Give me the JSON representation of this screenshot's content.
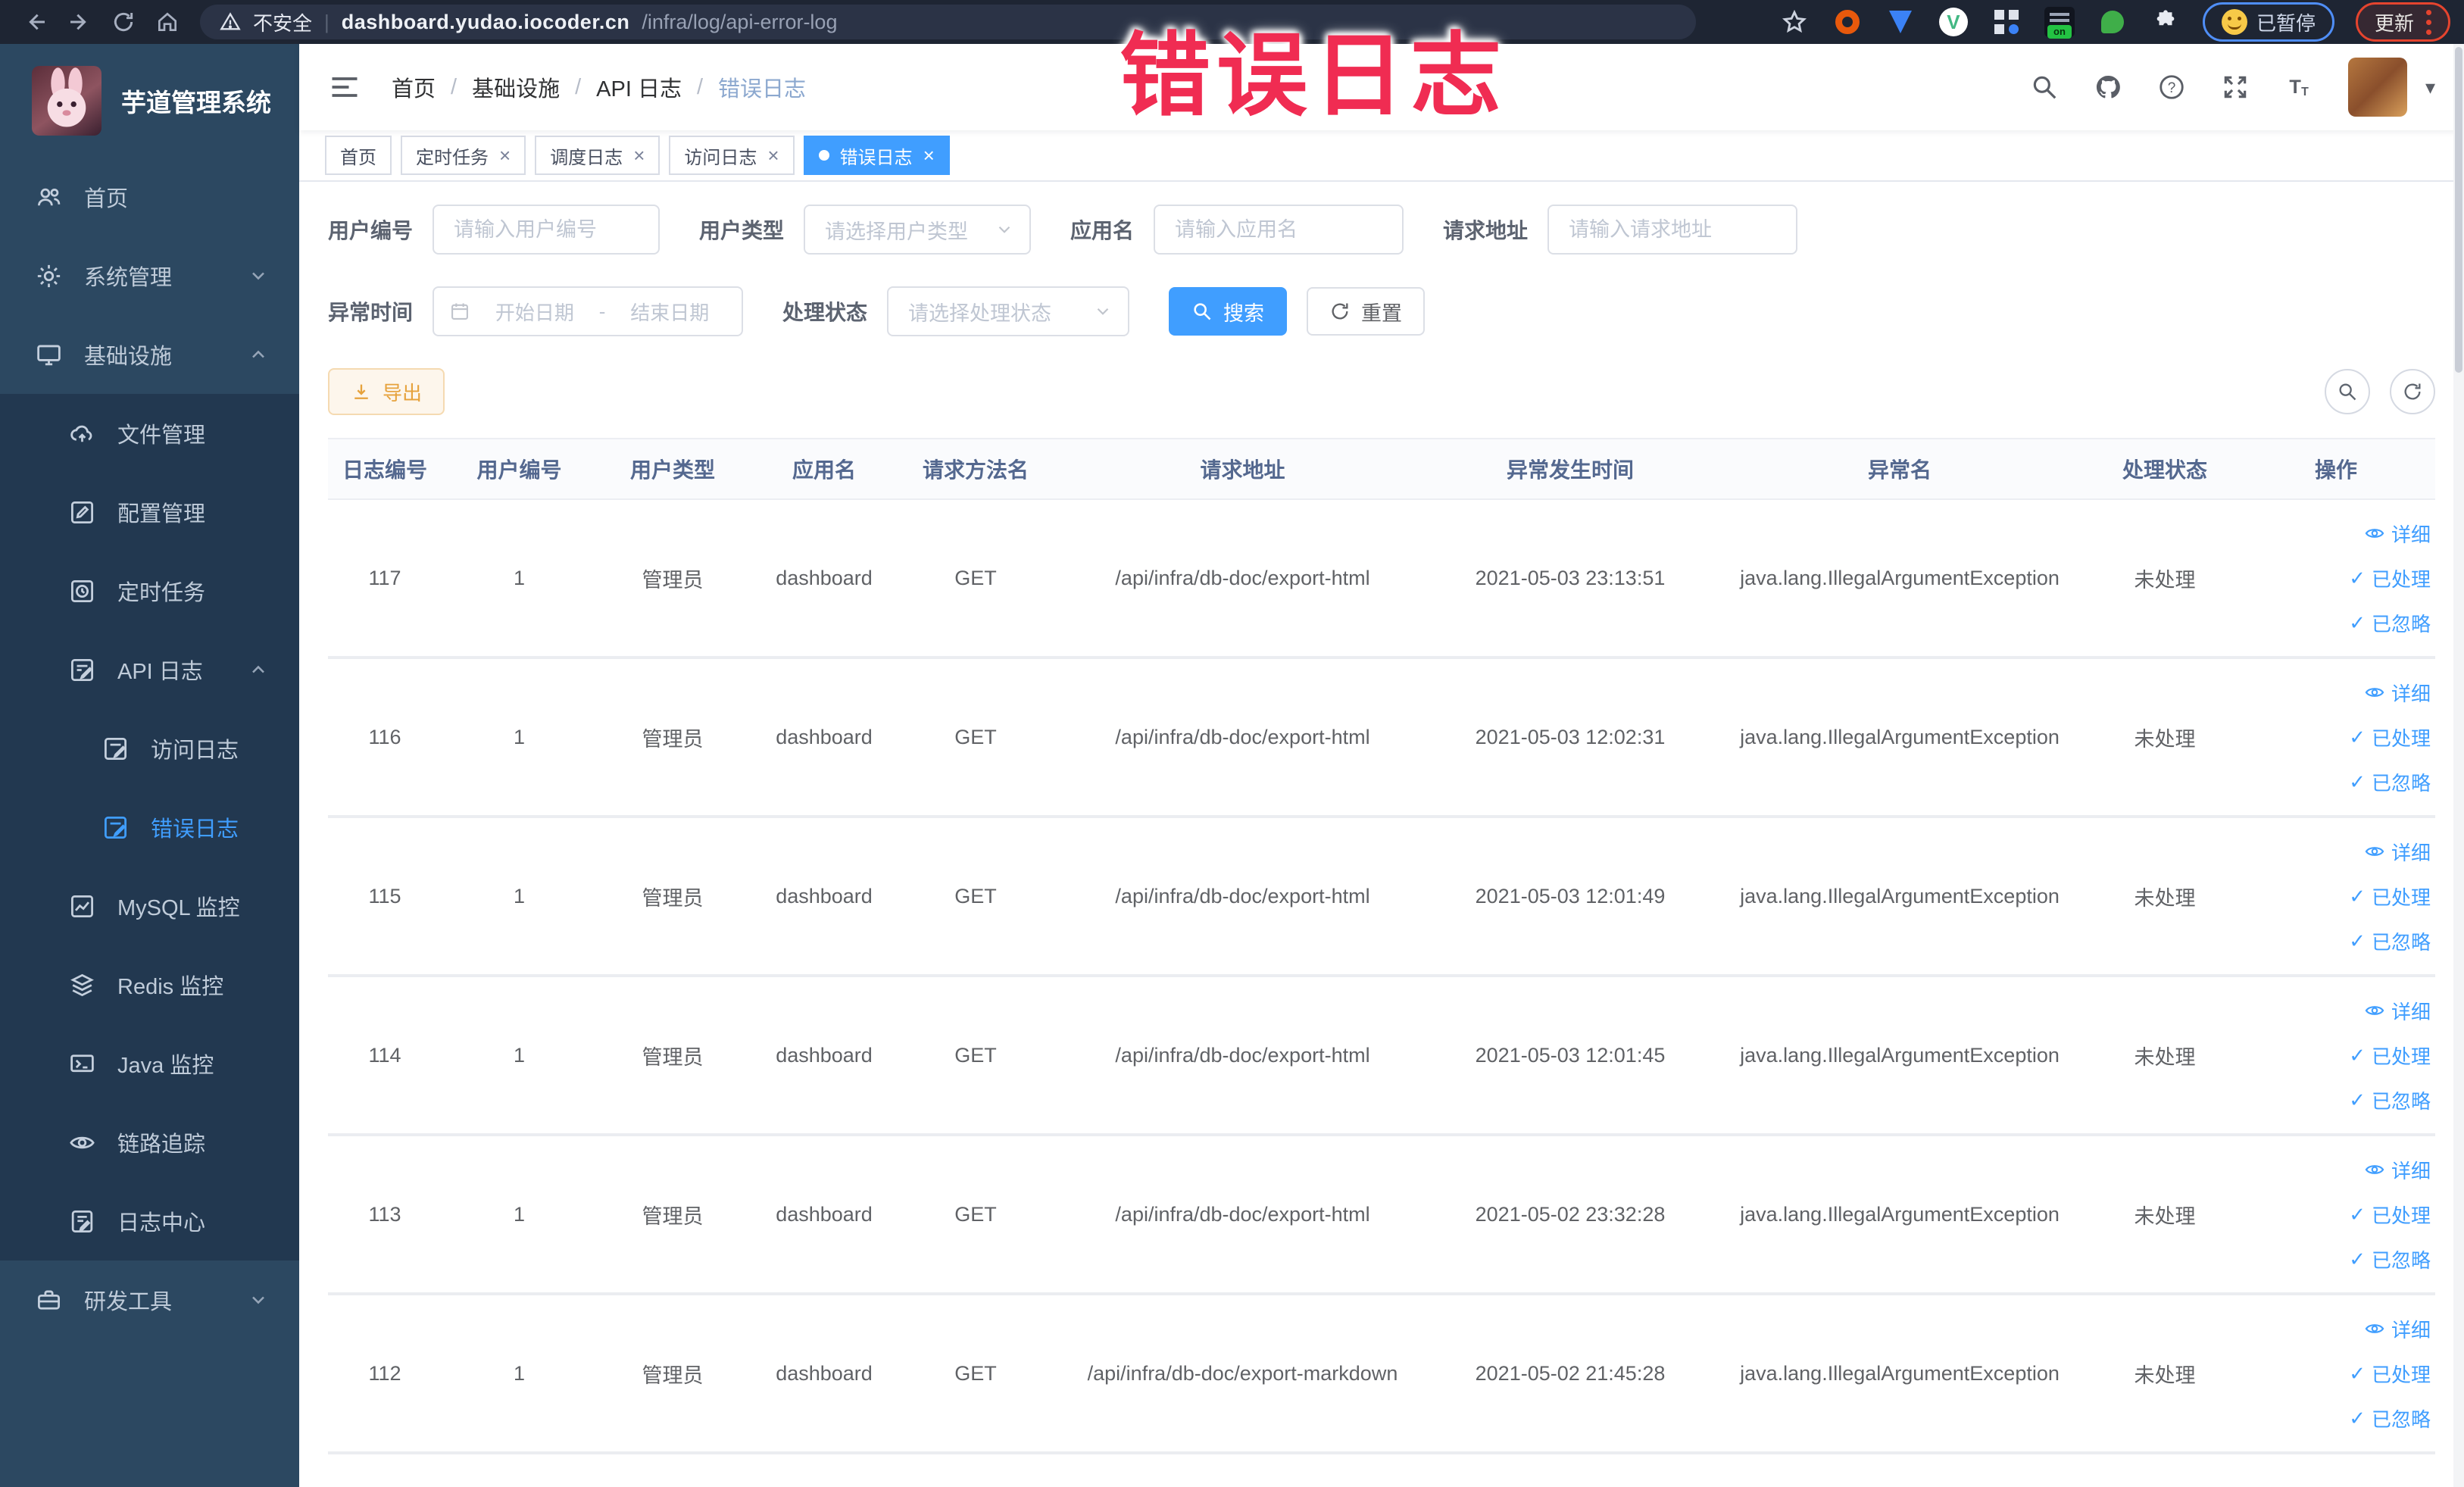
{
  "browser": {
    "security_label": "不安全",
    "url_domain": "dashboard.yudao.iocoder.cn",
    "url_path": "/infra/log/api-error-log",
    "paused_label": "已暂停",
    "update_label": "更新"
  },
  "annotation": {
    "text": "错误日志",
    "color": "#f02c52"
  },
  "icons": {
    "check": "✓",
    "close": "×",
    "caret_down": "▾",
    "slash": "/",
    "pipe": "|",
    "question": "?",
    "letter_big": "T",
    "letter_small": "T"
  },
  "sidebar": {
    "title": "芋道管理系统",
    "items": [
      {
        "label": "首页"
      },
      {
        "label": "系统管理"
      },
      {
        "label": "基础设施"
      },
      {
        "label": "文件管理"
      },
      {
        "label": "配置管理"
      },
      {
        "label": "定时任务"
      },
      {
        "label": "API 日志"
      },
      {
        "label": "访问日志"
      },
      {
        "label": "错误日志"
      },
      {
        "label": "MySQL 监控"
      },
      {
        "label": "Redis 监控"
      },
      {
        "label": "Java 监控"
      },
      {
        "label": "链路追踪"
      },
      {
        "label": "日志中心"
      },
      {
        "label": "研发工具"
      }
    ]
  },
  "breadcrumb": [
    "首页",
    "基础设施",
    "API 日志",
    "错误日志"
  ],
  "tabs": [
    {
      "label": "首页"
    },
    {
      "label": "定时任务"
    },
    {
      "label": "调度日志"
    },
    {
      "label": "访问日志"
    },
    {
      "label": "错误日志"
    }
  ],
  "filters": {
    "user_id_label": "用户编号",
    "user_id_placeholder": "请输入用户编号",
    "user_type_label": "用户类型",
    "user_type_placeholder": "请选择用户类型",
    "app_name_label": "应用名",
    "app_name_placeholder": "请输入应用名",
    "request_url_label": "请求地址",
    "request_url_placeholder": "请输入请求地址",
    "exception_time_label": "异常时间",
    "date_start_placeholder": "开始日期",
    "date_separator": "-",
    "date_end_placeholder": "结束日期",
    "process_status_label": "处理状态",
    "process_status_placeholder": "请选择处理状态",
    "search_label": "搜索",
    "reset_label": "重置"
  },
  "toolbar": {
    "export_label": "导出"
  },
  "table": {
    "columns": [
      "日志编号",
      "用户编号",
      "用户类型",
      "应用名",
      "请求方法名",
      "请求地址",
      "异常发生时间",
      "异常名",
      "处理状态",
      "操作"
    ],
    "action_labels": {
      "detail": "详细",
      "processed": "已处理",
      "ignored": "已忽略"
    },
    "rows": [
      {
        "log_id": "117",
        "user_id": "1",
        "user_type": "管理员",
        "app_name": "dashboard",
        "method": "GET",
        "url": "/api/infra/db-doc/export-html",
        "time": "2021-05-03 23:13:51",
        "exception": "java.lang.IllegalArgumentException",
        "status": "未处理"
      },
      {
        "log_id": "116",
        "user_id": "1",
        "user_type": "管理员",
        "app_name": "dashboard",
        "method": "GET",
        "url": "/api/infra/db-doc/export-html",
        "time": "2021-05-03 12:02:31",
        "exception": "java.lang.IllegalArgumentException",
        "status": "未处理"
      },
      {
        "log_id": "115",
        "user_id": "1",
        "user_type": "管理员",
        "app_name": "dashboard",
        "method": "GET",
        "url": "/api/infra/db-doc/export-html",
        "time": "2021-05-03 12:01:49",
        "exception": "java.lang.IllegalArgumentException",
        "status": "未处理"
      },
      {
        "log_id": "114",
        "user_id": "1",
        "user_type": "管理员",
        "app_name": "dashboard",
        "method": "GET",
        "url": "/api/infra/db-doc/export-html",
        "time": "2021-05-03 12:01:45",
        "exception": "java.lang.IllegalArgumentException",
        "status": "未处理"
      },
      {
        "log_id": "113",
        "user_id": "1",
        "user_type": "管理员",
        "app_name": "dashboard",
        "method": "GET",
        "url": "/api/infra/db-doc/export-html",
        "time": "2021-05-02 23:32:28",
        "exception": "java.lang.IllegalArgumentException",
        "status": "未处理"
      },
      {
        "log_id": "112",
        "user_id": "1",
        "user_type": "管理员",
        "app_name": "dashboard",
        "method": "GET",
        "url": "/api/infra/db-doc/export-markdown",
        "time": "2021-05-02 21:45:28",
        "exception": "java.lang.IllegalArgumentException",
        "status": "未处理"
      }
    ]
  },
  "colors": {
    "primary": "#409eff",
    "warning": "#e6a23c",
    "sidebar_bg": "#2c4861",
    "submenu_bg": "#223850"
  }
}
